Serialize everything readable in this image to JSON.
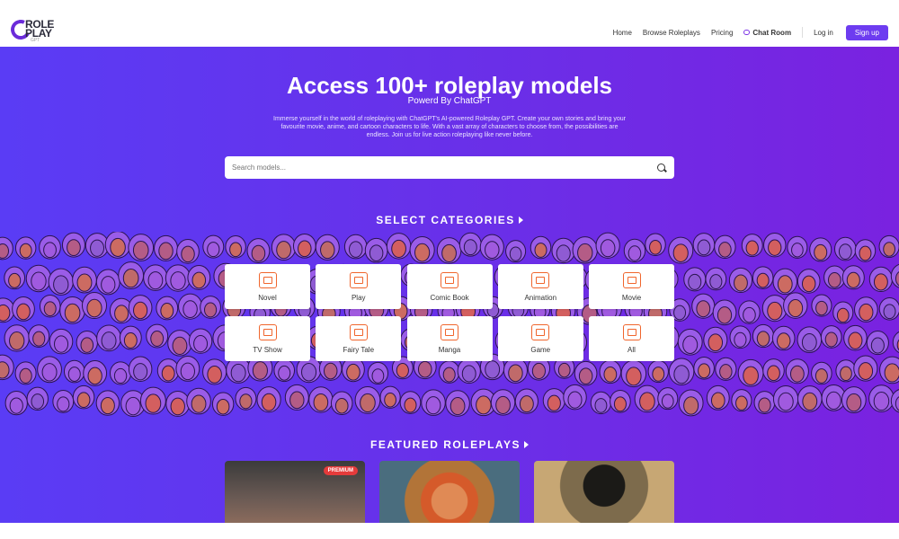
{
  "header": {
    "logo_text_line1": "ROLE",
    "logo_text_line2": "PLAY",
    "logo_sub": "GPT",
    "nav": {
      "home": "Home",
      "browse": "Browse Roleplays",
      "pricing": "Pricing",
      "chat_room": "Chat Room",
      "login": "Log in",
      "signup": "Sign up"
    }
  },
  "hero": {
    "title": "Access 100+ roleplay models",
    "subtitle": "Powerd By ChatGPT",
    "description": "Immerse yourself in the world of roleplaying with ChatGPT's AI-powered Roleplay GPT. Create your own stories and bring your favourite movie, anime, and cartoon characters to life. With a vast array of characters to choose from, the possibilities are endless. Join us for live action roleplaying like never before.",
    "search_placeholder": "Search models..."
  },
  "categories": {
    "title": "SELECT CATEGORIES",
    "items": [
      {
        "label": "Novel",
        "icon": "book-icon"
      },
      {
        "label": "Play",
        "icon": "theater-masks-icon"
      },
      {
        "label": "Comic Book",
        "icon": "comic-book-icon"
      },
      {
        "label": "Animation",
        "icon": "animation-screen-icon"
      },
      {
        "label": "Movie",
        "icon": "clapperboard-icon"
      },
      {
        "label": "TV Show",
        "icon": "tv-icon"
      },
      {
        "label": "Fairy Tale",
        "icon": "fairy-tale-book-icon"
      },
      {
        "label": "Manga",
        "icon": "manga-icon"
      },
      {
        "label": "Game",
        "icon": "gamepad-icon"
      },
      {
        "label": "All",
        "icon": "all-books-icon"
      }
    ]
  },
  "featured": {
    "title": "FEATURED ROLEPLAYS",
    "cards": [
      {
        "badge": "PREMIUM"
      },
      {
        "badge": ""
      },
      {
        "badge": ""
      }
    ]
  },
  "colors": {
    "hero_gradient_start": "#5a3cf5",
    "hero_gradient_end": "#7a22e0",
    "accent": "#6d3cf0",
    "icon_orange": "#f0662d",
    "badge_red": "#e53b3b"
  }
}
